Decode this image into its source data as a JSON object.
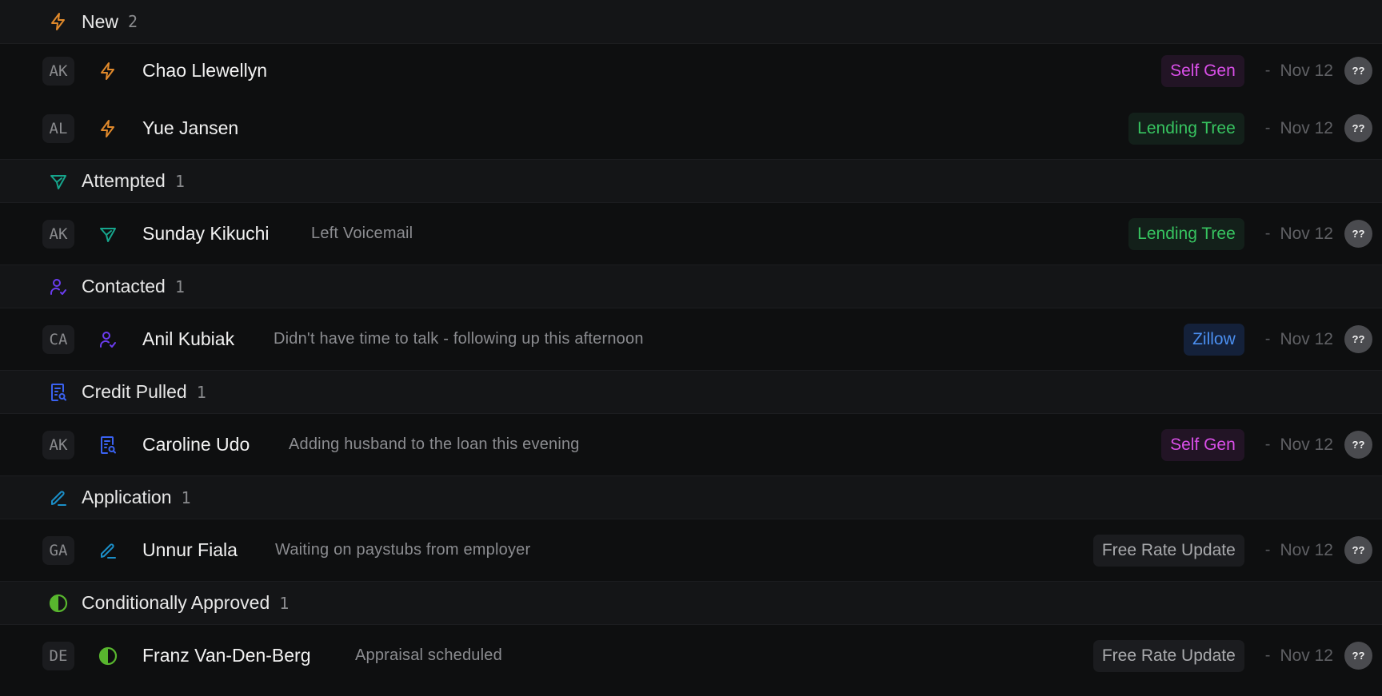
{
  "colors": {
    "new": "#e0892b",
    "attempted": "#16a58c",
    "contacted": "#6b3df0",
    "credit_pulled": "#3a62f2",
    "application": "#1b8fc9",
    "conditionally_approved": "#58b62e"
  },
  "groups": [
    {
      "title": "New",
      "count": "2",
      "icon": "lightning-icon",
      "rows": [
        {
          "initials": "AK",
          "name": "Chao Llewellyn",
          "note": "",
          "source": "Self Gen",
          "dash": "-",
          "date": "Nov 12",
          "owner": "??"
        },
        {
          "initials": "AL",
          "name": "Yue Jansen",
          "note": "",
          "source": "Lending Tree",
          "dash": "-",
          "date": "Nov 12",
          "owner": "??"
        }
      ]
    },
    {
      "title": "Attempted",
      "count": "1",
      "icon": "send-icon",
      "rows": [
        {
          "initials": "AK",
          "name": "Sunday Kikuchi",
          "note": "Left Voicemail",
          "source": "Lending Tree",
          "dash": "-",
          "date": "Nov 12",
          "owner": "??"
        }
      ]
    },
    {
      "title": "Contacted",
      "count": "1",
      "icon": "user-check-icon",
      "rows": [
        {
          "initials": "CA",
          "name": "Anil Kubiak",
          "note": "Didn't have time to talk - following up this afternoon",
          "source": "Zillow",
          "dash": "-",
          "date": "Nov 12",
          "owner": "??"
        }
      ]
    },
    {
      "title": "Credit Pulled",
      "count": "1",
      "icon": "document-search-icon",
      "rows": [
        {
          "initials": "AK",
          "name": "Caroline Udo",
          "note": "Adding husband to the loan this evening",
          "source": "Self Gen",
          "dash": "-",
          "date": "Nov 12",
          "owner": "??"
        }
      ]
    },
    {
      "title": "Application",
      "count": "1",
      "icon": "pen-icon",
      "rows": [
        {
          "initials": "GA",
          "name": "Unnur Fiala",
          "note": "Waiting on paystubs from employer",
          "source": "Free Rate Update",
          "dash": "-",
          "date": "Nov 12",
          "owner": "??"
        }
      ]
    },
    {
      "title": "Conditionally Approved",
      "count": "1",
      "icon": "half-circle-icon",
      "rows": [
        {
          "initials": "DE",
          "name": "Franz Van-Den-Berg",
          "note": "Appraisal scheduled",
          "source": "Free Rate Update",
          "dash": "-",
          "date": "Nov 12",
          "owner": "??"
        }
      ]
    }
  ]
}
